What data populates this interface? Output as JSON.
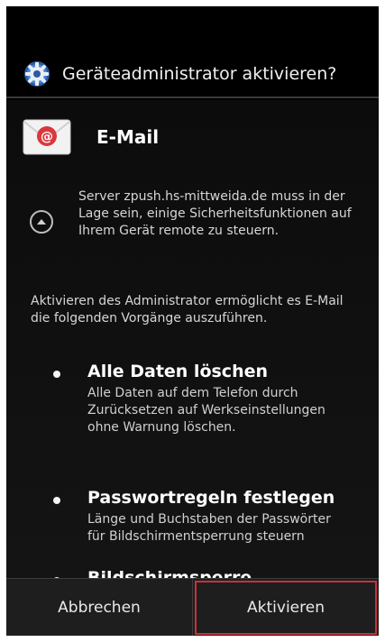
{
  "dialog": {
    "title": "Geräteadministrator aktivieren?",
    "icon": "settings-gear-icon"
  },
  "app": {
    "name": "E-Mail",
    "icon": "email-app-icon"
  },
  "server_notice": {
    "icon": "expand-circle-icon",
    "text": "Server zpush.hs-mittweida.de muss in der Lage sein, einige Sicherheitsfunktionen auf Ihrem Gerät remote zu steuern."
  },
  "intro_text": "Aktivieren des Administrator ermöglicht es E-Mail die folgenden Vorgänge auszuführen.",
  "permissions": [
    {
      "title": "Alle Daten löschen",
      "description": "Alle Daten auf dem Telefon durch Zurücksetzen auf Werkseinstellungen ohne Warnung löschen."
    },
    {
      "title": "Passwortregeln festlegen",
      "description": "Länge und Buchstaben der Passwörter für Bildschirmentsperrung steuern"
    },
    {
      "title": "Bildschirmsperre",
      "description": ""
    }
  ],
  "buttons": {
    "cancel": "Abbrechen",
    "activate": "Aktivieren"
  },
  "colors": {
    "highlight": "#c8303b",
    "mail_red": "#d8383e"
  }
}
